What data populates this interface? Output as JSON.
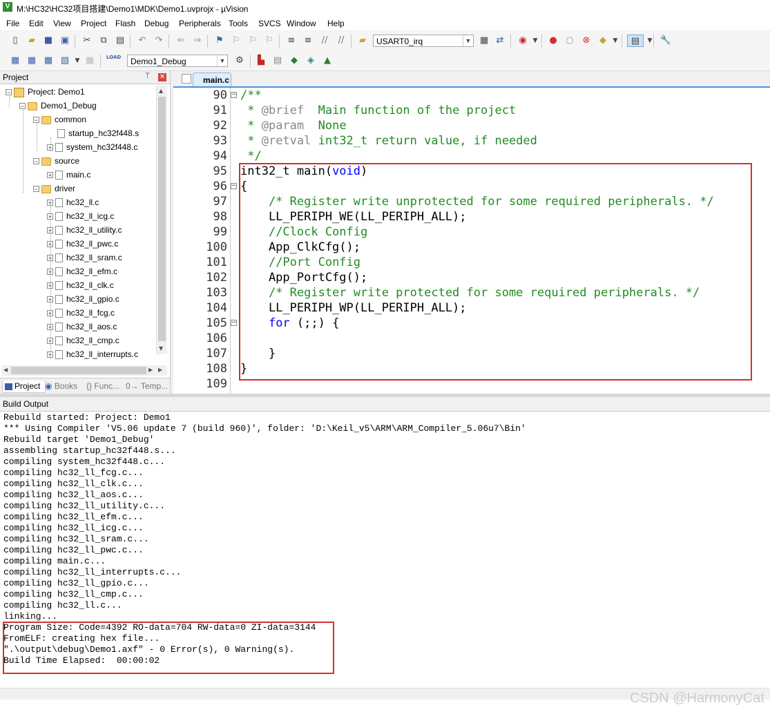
{
  "window": {
    "title": "M:\\HC32\\HC32项目搭建\\Demo1\\MDK\\Demo1.uvprojx - µVision",
    "app_icon": "V"
  },
  "menu": [
    "File",
    "Edit",
    "View",
    "Project",
    "Flash",
    "Debug",
    "Peripherals",
    "Tools",
    "SVCS",
    "Window",
    "Help"
  ],
  "toolbar1": {
    "function_combo": "USART0_irq"
  },
  "toolbar2": {
    "target_combo": "Demo1_Debug",
    "load_label": "LOAD"
  },
  "project_panel": {
    "header": "Project",
    "pin": "ᛘ",
    "close": "✕",
    "tree": {
      "root": "Project: Demo1",
      "target": "Demo1_Debug",
      "groups": [
        {
          "name": "common",
          "files": [
            "startup_hc32f448.s",
            "system_hc32f448.c"
          ]
        },
        {
          "name": "source",
          "files": [
            "main.c"
          ]
        },
        {
          "name": "driver",
          "files": [
            "hc32_ll.c",
            "hc32_ll_icg.c",
            "hc32_ll_utility.c",
            "hc32_ll_pwc.c",
            "hc32_ll_sram.c",
            "hc32_ll_efm.c",
            "hc32_ll_clk.c",
            "hc32_ll_gpio.c",
            "hc32_ll_fcg.c",
            "hc32_ll_aos.c",
            "hc32_ll_cmp.c",
            "hc32_ll_interrupts.c"
          ]
        }
      ]
    },
    "tabs": [
      "Project",
      "Books",
      "{} Func...",
      "0→ Temp..."
    ]
  },
  "editor": {
    "tab": "main.c",
    "lines": [
      {
        "n": "90",
        "fold": "−",
        "html": [
          [
            "/**",
            "cm"
          ]
        ]
      },
      {
        "n": "91",
        "fold": "",
        "html": [
          [
            " * ",
            "cm"
          ],
          [
            "@brief",
            "tag"
          ],
          [
            "  Main function of the project",
            "cm"
          ]
        ]
      },
      {
        "n": "92",
        "fold": "",
        "html": [
          [
            " * ",
            "cm"
          ],
          [
            "@param",
            "tag"
          ],
          [
            "  None",
            "cm"
          ]
        ]
      },
      {
        "n": "93",
        "fold": "",
        "html": [
          [
            " * ",
            "cm"
          ],
          [
            "@retval",
            "tag"
          ],
          [
            " int32_t return value, if needed",
            "cm"
          ]
        ]
      },
      {
        "n": "94",
        "fold": "",
        "html": [
          [
            " */",
            "cm"
          ]
        ]
      },
      {
        "n": "95",
        "fold": "",
        "html": [
          [
            "int32_t main(",
            ""
          ],
          [
            "void",
            "kw"
          ],
          [
            ")",
            ""
          ]
        ]
      },
      {
        "n": "96",
        "fold": "−",
        "html": [
          [
            "{",
            ""
          ]
        ]
      },
      {
        "n": "97",
        "fold": "",
        "html": [
          [
            "    ",
            ""
          ],
          [
            "/* Register write unprotected for some required peripherals. */",
            "cm"
          ]
        ]
      },
      {
        "n": "98",
        "fold": "",
        "html": [
          [
            "    LL_PERIPH_WE(LL_PERIPH_ALL);",
            ""
          ]
        ]
      },
      {
        "n": "99",
        "fold": "",
        "html": [
          [
            "    ",
            ""
          ],
          [
            "//Clock Config",
            "cm"
          ]
        ]
      },
      {
        "n": "100",
        "fold": "",
        "html": [
          [
            "    App_ClkCfg();",
            ""
          ]
        ]
      },
      {
        "n": "101",
        "fold": "",
        "html": [
          [
            "    ",
            ""
          ],
          [
            "//Port Config",
            "cm"
          ]
        ]
      },
      {
        "n": "102",
        "fold": "",
        "html": [
          [
            "    App_PortCfg();",
            ""
          ]
        ]
      },
      {
        "n": "103",
        "fold": "",
        "html": [
          [
            "    ",
            ""
          ],
          [
            "/* Register write protected for some required peripherals. */",
            "cm"
          ]
        ]
      },
      {
        "n": "104",
        "fold": "",
        "html": [
          [
            "    LL_PERIPH_WP(LL_PERIPH_ALL);",
            ""
          ]
        ]
      },
      {
        "n": "105",
        "fold": "−",
        "html": [
          [
            "    ",
            ""
          ],
          [
            "for",
            "kw"
          ],
          [
            " (;;) {",
            ""
          ]
        ]
      },
      {
        "n": "106",
        "fold": "",
        "html": [
          [
            "",
            ""
          ]
        ]
      },
      {
        "n": "107",
        "fold": "",
        "html": [
          [
            "    }",
            ""
          ]
        ]
      },
      {
        "n": "108",
        "fold": "",
        "html": [
          [
            "}",
            ""
          ]
        ]
      },
      {
        "n": "109",
        "fold": "",
        "html": [
          [
            "",
            ""
          ]
        ]
      }
    ]
  },
  "build_output": {
    "header": "Build Output",
    "lines": [
      "Rebuild started: Project: Demo1",
      "*** Using Compiler 'V5.06 update 7 (build 960)', folder: 'D:\\Keil_v5\\ARM\\ARM_Compiler_5.06u7\\Bin'",
      "Rebuild target 'Demo1_Debug'",
      "assembling startup_hc32f448.s...",
      "compiling system_hc32f448.c...",
      "compiling hc32_ll_fcg.c...",
      "compiling hc32_ll_clk.c...",
      "compiling hc32_ll_aos.c...",
      "compiling hc32_ll_utility.c...",
      "compiling hc32_ll_efm.c...",
      "compiling hc32_ll_icg.c...",
      "compiling hc32_ll_sram.c...",
      "compiling hc32_ll_pwc.c...",
      "compiling main.c...",
      "compiling hc32_ll_interrupts.c...",
      "compiling hc32_ll_gpio.c...",
      "compiling hc32_ll_cmp.c...",
      "compiling hc32_ll.c...",
      "linking...",
      "Program Size: Code=4392 RO-data=704 RW-data=0 ZI-data=3144",
      "FromELF: creating hex file...",
      "\".\\output\\debug\\Demo1.axf\" - 0 Error(s), 0 Warning(s).",
      "Build Time Elapsed:  00:00:02"
    ]
  },
  "watermark": "CSDN @HarmonyCat",
  "colors": {
    "highlight_box": "#d32f2f",
    "comment": "#228b22",
    "keyword": "#0000ff"
  }
}
